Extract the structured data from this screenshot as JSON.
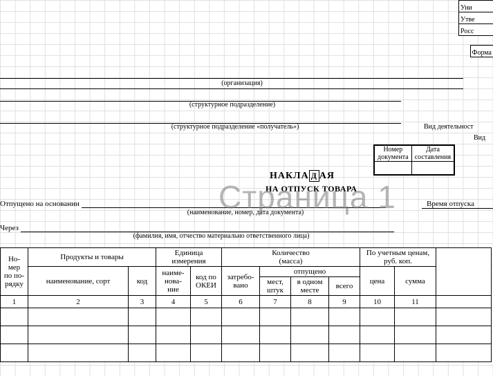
{
  "top_right": {
    "line1": "Уни",
    "line2": "Утве",
    "line3": "Росс",
    "forma": "Форма"
  },
  "captions": {
    "org": "(организация)",
    "struct1": "(структурное подразделение)",
    "struct2": "(структурное подразделение «получатель»)",
    "doc_details": "(наименование, номер, дата документа)",
    "fio": "(фамилия, имя, отчество материально ответственного лица)"
  },
  "side": {
    "vid1": "Вид деятельност",
    "vid2": "Вид"
  },
  "docbox": {
    "h1a": "Номер",
    "h1b": "документа",
    "h2a": "Дата",
    "h2b": "составления",
    "num": "",
    "date": ""
  },
  "title": {
    "word_left": "НАКЛА",
    "drop": "Д",
    "word_right": "АЯ",
    "sub": "НА ОТПУСК ТОВАРА"
  },
  "watermark": "Страница 1",
  "labels": {
    "otpushcheno": "Отпущено на основании",
    "cherez": "Через",
    "time": "Время отпуска"
  },
  "table": {
    "h": {
      "no_a": "Но-",
      "no_b": "мер",
      "no_c": "по по-",
      "no_d": "рядку",
      "prod": "Продукты и товары",
      "unit": "Единица",
      "unit2": "измерения",
      "qty": "Количество",
      "qty2": "(масса)",
      "price_a": "По учетным ценам,",
      "price_b": "руб. коп.",
      "name_sort": "наименование, сорт",
      "code": "код",
      "naim_a": "наиме-",
      "naim_b": "нова-",
      "naim_c": "ние",
      "okei_a": "код по",
      "okei_b": "ОКЕИ",
      "req_a": "затребо-",
      "req_b": "вано",
      "rel": "отпущено",
      "mest_a": "мест,",
      "mest_b": "штук",
      "one_a": "в одном",
      "one_b": "месте",
      "total": "всего",
      "cena": "цена",
      "summa": "сумма"
    },
    "nums": [
      "1",
      "2",
      "3",
      "4",
      "5",
      "6",
      "7",
      "8",
      "9",
      "10",
      "11"
    ],
    "rows": 3
  }
}
